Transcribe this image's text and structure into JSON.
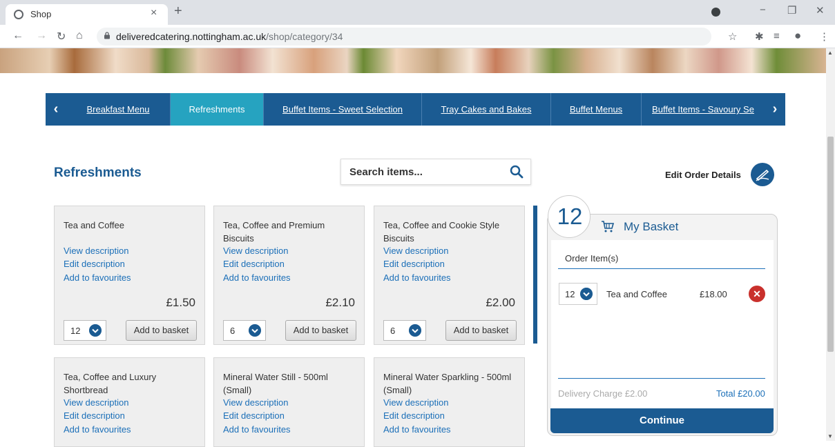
{
  "browser": {
    "tab_title": "Shop",
    "url_domain": "deliveredcatering.nottingham.ac.uk",
    "url_path": "/shop/category/34",
    "close_tab": "×",
    "new_tab": "+",
    "minimize": "−",
    "restore": "❐",
    "close_window": "✕"
  },
  "categories": [
    {
      "label": "Breakfast Menu",
      "active": false
    },
    {
      "label": "Refreshments",
      "active": true
    },
    {
      "label": "Buffet Items - Sweet Selection",
      "active": false
    },
    {
      "label": "Tray Cakes and Bakes",
      "active": false
    },
    {
      "label": "Buffet Menus",
      "active": false
    },
    {
      "label": "Buffet Items - Savoury Se",
      "active": false
    }
  ],
  "page": {
    "title": "Refreshments",
    "search_placeholder": "Search items...",
    "edit_order_label": "Edit Order Details"
  },
  "card_links": {
    "view": "View description",
    "edit": "Edit description",
    "fav": "Add to favourites",
    "add": "Add to basket"
  },
  "products": [
    {
      "name": "Tea and Coffee",
      "price": "£1.50",
      "qty": "12"
    },
    {
      "name": "Tea, Coffee and Premium Biscuits",
      "price": "£2.10",
      "qty": "6"
    },
    {
      "name": "Tea, Coffee and Cookie Style Biscuits",
      "price": "£2.00",
      "qty": "6"
    },
    {
      "name": "Tea, Coffee and Luxury Shortbread"
    },
    {
      "name": "Mineral Water Still - 500ml (Small)"
    },
    {
      "name": "Mineral Water Sparkling - 500ml (Small)"
    }
  ],
  "basket": {
    "count": "12",
    "title": "My Basket",
    "order_items_label": "Order Item(s)",
    "items": [
      {
        "qty": "12",
        "name": "Tea and Coffee",
        "price": "£18.00"
      }
    ],
    "delivery": "Delivery Charge £2.00",
    "total": "Total £20.00",
    "continue_label": "Continue"
  },
  "colors": {
    "brand_blue": "#1b5b92",
    "active_tab": "#26a3c0",
    "link": "#1b6fb8",
    "remove_red": "#c9302c"
  }
}
